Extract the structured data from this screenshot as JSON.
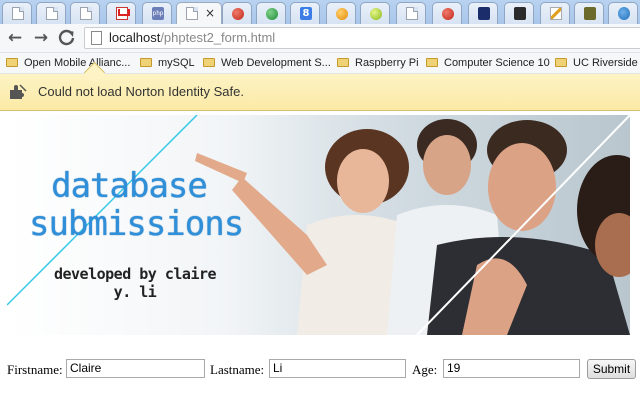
{
  "tabs": [
    {
      "icon": "page-icon",
      "active": false
    },
    {
      "icon": "page-icon",
      "active": false
    },
    {
      "icon": "page-icon",
      "active": false
    },
    {
      "icon": "gmail-icon",
      "active": false
    },
    {
      "icon": "php-icon",
      "label": "php",
      "active": false
    },
    {
      "icon": "page-icon",
      "active": true,
      "close": "×"
    },
    {
      "icon": "red-circle-icon",
      "active": false
    },
    {
      "icon": "green-shield-icon",
      "active": false
    },
    {
      "icon": "google-8-icon",
      "label": "8",
      "active": false
    },
    {
      "icon": "orange-circle-icon",
      "active": false
    },
    {
      "icon": "green-circle-icon",
      "active": false
    },
    {
      "icon": "page-icon",
      "active": false
    },
    {
      "icon": "red-circle-icon",
      "active": false
    },
    {
      "icon": "navy-square-icon",
      "active": false
    },
    {
      "icon": "dark-square-icon",
      "active": false
    },
    {
      "icon": "pencil-icon",
      "active": false
    },
    {
      "icon": "olive-square-icon",
      "active": false
    },
    {
      "icon": "drupal-icon",
      "active": false
    }
  ],
  "toolbar": {
    "back": "←",
    "forward": "→",
    "reload": "C",
    "url_host": "localhost",
    "url_path": "/phptest2_form.html"
  },
  "bookmarks": [
    "Open Mobile Allianc...",
    "mySQL",
    "Web Development S...",
    "Raspberry Pi",
    "Computer Science 10",
    "UC Riverside"
  ],
  "infobar": {
    "message": "Could not load Norton Identity Safe."
  },
  "banner": {
    "title_line1": "database",
    "title_line2": "submissions",
    "subtitle": "developed by claire y. li",
    "accent_color": "#2f8fd8"
  },
  "form": {
    "firstname_label": "Firstname:",
    "firstname_value": "Claire",
    "lastname_label": "Lastname:",
    "lastname_value": "Li",
    "age_label": "Age:",
    "age_value": "19",
    "submit_label": "Submit"
  }
}
